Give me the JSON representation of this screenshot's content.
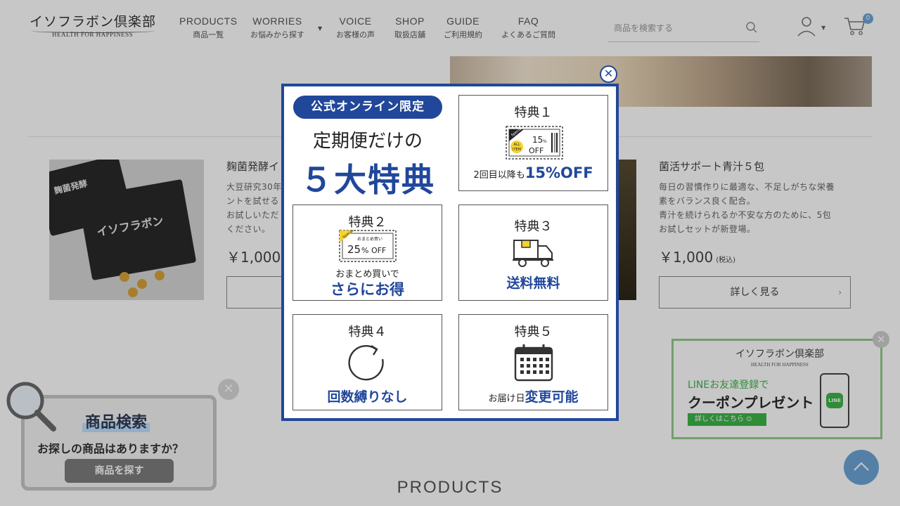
{
  "header": {
    "logo_jp": "イソフラボン倶楽部",
    "logo_en": "HEALTH FOR HAPPINESS",
    "nav": [
      {
        "en": "PRODUCTS",
        "jp": "商品一覧"
      },
      {
        "en": "WORRIES",
        "jp": "お悩みから探す"
      },
      {
        "en": "VOICE",
        "jp": "お客様の声"
      },
      {
        "en": "SHOP",
        "jp": "取扱店舗"
      },
      {
        "en": "GUIDE",
        "jp": "ご利用規約"
      },
      {
        "en": "FAQ",
        "jp": "よくあるご質問"
      }
    ],
    "search_placeholder": "商品を検索する",
    "cart_count": "0"
  },
  "products": [
    {
      "title": "麹菌発酵イ",
      "desc": [
        "大豆研究30年",
        "ントを試せる",
        "お試しいただ",
        "ください。"
      ],
      "price": "￥1,000"
    },
    {
      "title": "菌活サポート青汁５包",
      "desc": [
        "毎日の習慣作りに最適な、不足しがちな栄養",
        "素をバランス良く配合。",
        "青汁を続けられるか不安な方のために、5包",
        "お試しセットが新登場。"
      ],
      "price": "￥1,000",
      "tax": "(税込)",
      "button": "詳しく見る"
    }
  ],
  "products_heading": "PRODUCTS",
  "search_widget": {
    "title": "商品検索",
    "subtitle": "お探しの商品はありますか？",
    "button": "商品を探す"
  },
  "line_widget": {
    "logo_jp": "イソフラボン倶楽部",
    "logo_en": "HEALTH FOR HAPPINESS",
    "subtitle": "LINEお友達登録で",
    "title": "クーポンプレゼント",
    "button": "詳しくはこちら ⊙",
    "line_label": "LINE"
  },
  "modal": {
    "pill": "公式オンライン限定",
    "subtitle": "定期便だけの",
    "headline": "５大特典",
    "benefits": [
      {
        "title": "特典１",
        "coupon_pct": "15",
        "coupon_off": "OFF",
        "coupon_tag": "Special",
        "coupon_all": "ALL",
        "coupon_item": "ITEM",
        "foot_dark": "2回目以降も",
        "foot_blue": "15%OFF"
      },
      {
        "title": "特典２",
        "coupon_pct": "25",
        "coupon_off": "% OFF",
        "coupon_tag": "Special",
        "coupon_note": "おまとめ買い",
        "foot_dark": "おまとめ買いで",
        "foot_blue": "さらにお得"
      },
      {
        "title": "特典３",
        "foot_blue": "送料無料"
      },
      {
        "title": "特典４",
        "foot_blue": "回数縛りなし"
      },
      {
        "title": "特典５",
        "foot_dark": "お届け日",
        "foot_blue": "変更可能"
      }
    ]
  },
  "colors": {
    "brand_blue": "#21479b",
    "accent_blue": "#6ca4d8",
    "line_green": "#3db548"
  }
}
